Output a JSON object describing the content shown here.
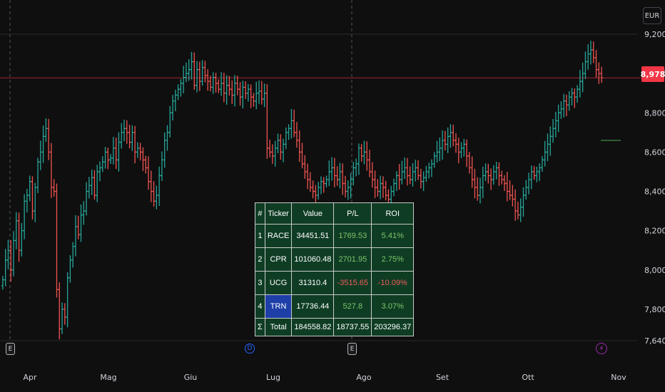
{
  "currency": "EUR",
  "last_price": "8,978",
  "chart_data": {
    "type": "ohlc",
    "x_axis": {
      "months": [
        "Apr",
        "Mag",
        "Giu",
        "Lug",
        "Ago",
        "Set",
        "Ott",
        "Nov"
      ]
    },
    "y_axis": {
      "ticks": [
        "9,200",
        "9,000",
        "8,800",
        "8,600",
        "8,400",
        "8,200",
        "8,000",
        "7,800",
        "7,640"
      ],
      "ylim": [
        7640,
        9200
      ]
    },
    "last_price_value": 8978,
    "up_color": "#26a69a",
    "down_color": "#ef5350",
    "series_close": [
      7950,
      8050,
      8100,
      8000,
      8150,
      8250,
      8100,
      8200,
      8350,
      8380,
      8450,
      8300,
      8420,
      8550,
      8600,
      8680,
      8720,
      8600,
      8420,
      8400,
      7900,
      7700,
      7800,
      7760,
      7960,
      8050,
      8120,
      8220,
      8180,
      8280,
      8300,
      8400,
      8430,
      8470,
      8380,
      8500,
      8520,
      8550,
      8600,
      8560,
      8570,
      8620,
      8560,
      8650,
      8700,
      8720,
      8700,
      8650,
      8700,
      8600,
      8620,
      8600,
      8560,
      8520,
      8450,
      8400,
      8350,
      8380,
      8480,
      8560,
      8660,
      8700,
      8800,
      8860,
      8890,
      8920,
      8950,
      8980,
      9000,
      9020,
      9060,
      8940,
      9020,
      8960,
      9030,
      8990,
      8960,
      8930,
      8980,
      8950,
      8920,
      8950,
      8900,
      8940,
      8920,
      8890,
      8950,
      8920,
      8880,
      8930,
      8900,
      8920,
      8880,
      8860,
      8900,
      8910,
      8870,
      8900,
      8620,
      8600,
      8580,
      8620,
      8660,
      8600,
      8640,
      8700,
      8720,
      8760,
      8700,
      8660,
      8600,
      8540,
      8500,
      8460,
      8420,
      8400,
      8380,
      8420,
      8450,
      8440,
      8460,
      8500,
      8520,
      8480,
      8460,
      8500,
      8440,
      8400,
      8420,
      8460,
      8520,
      8540,
      8620,
      8580,
      8600,
      8560,
      8500,
      8460,
      8420,
      8400,
      8440,
      8420,
      8380,
      8360,
      8400,
      8440,
      8480,
      8460,
      8500,
      8520,
      8480,
      8460,
      8500,
      8520,
      8480,
      8450,
      8470,
      8500,
      8520,
      8540,
      8580,
      8600,
      8620,
      8660,
      8640,
      8680,
      8700,
      8660,
      8640,
      8600,
      8620,
      8640,
      8580,
      8520,
      8460,
      8420,
      8380,
      8420,
      8480,
      8500,
      8480,
      8460,
      8500,
      8520,
      8480,
      8460,
      8440,
      8400,
      8380,
      8360,
      8300,
      8280,
      8320,
      8380,
      8420,
      8460,
      8500,
      8480,
      8500,
      8520,
      8560,
      8600,
      8640,
      8680,
      8720,
      8760,
      8800,
      8820,
      8860,
      8840,
      8880,
      8900,
      8880,
      8920,
      8960,
      9000,
      9060,
      9100,
      9120,
      9080,
      9020,
      9000,
      8978
    ]
  },
  "annotations": {
    "earnings_label": "E",
    "dividend_label": "D",
    "split_label": "⚡"
  },
  "table": {
    "headers": [
      "#",
      "Ticker",
      "Value",
      "P/L",
      "ROI"
    ],
    "rows": [
      {
        "n": "1",
        "ticker": "RACE",
        "value": "34451.51",
        "pl": "1769.53",
        "roi": "5.41%"
      },
      {
        "n": "2",
        "ticker": "CPR",
        "value": "101060.48",
        "pl": "2701.95",
        "roi": "2.75%"
      },
      {
        "n": "3",
        "ticker": "UCG",
        "value": "31310.4",
        "pl": "-3515.65",
        "roi": "-10.09%"
      },
      {
        "n": "4",
        "ticker": "TRN",
        "value": "17736.44",
        "pl": "527.8",
        "roi": "3.07%"
      }
    ],
    "total": {
      "n": "Σ",
      "ticker": "Total",
      "value": "184558.82",
      "pl": "18737.55",
      "roi": "203296.37"
    }
  }
}
